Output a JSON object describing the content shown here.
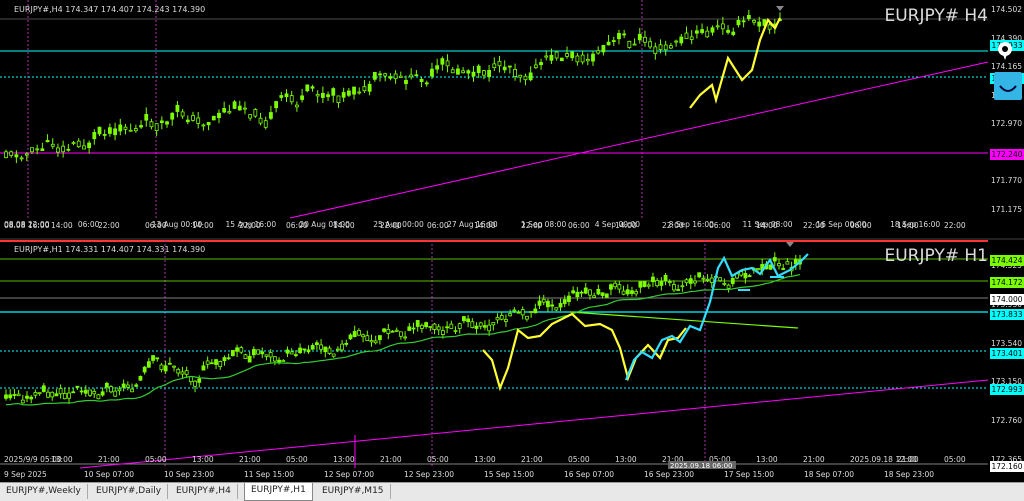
{
  "h4": {
    "header": "EURJPY#,H4  174.347 174.407 174.243 174.390",
    "big_label": "EURJPY#  H4",
    "price_labels": [
      "174.502",
      "174.390",
      "174.165",
      "173.565",
      "172.970",
      "172.370",
      "171.770",
      "171.175"
    ],
    "tags": [
      {
        "text": "173.933",
        "color": "#00ffff"
      },
      {
        "text": "173.601",
        "color": "#00ffff"
      },
      {
        "text": "172.240",
        "color": "#ff00ff"
      }
    ],
    "time_labels": [
      "08.08 22:00",
      "06:00",
      "13 Aug 00:00",
      "15 Aug 16:00",
      "20 Aug 08:00",
      "25 Aug 00:00",
      "27 Aug 16:00",
      "1 Sep 08:00",
      "4 Sep 00:00",
      "8 Sep 16:00",
      "11 Sep 08:00",
      "16 Sep 00:00",
      "18 Sep 16:00"
    ],
    "time_sub": [
      "08.08 16:00",
      "14:00",
      "22:00",
      "06:00",
      "14:00",
      "22:00",
      "06:00",
      "14:00",
      "22:00",
      "06:00",
      "14:00",
      "22:00",
      "06:00",
      "14:00",
      "22:00",
      "06:00",
      "14:00",
      "22:00",
      "06:00",
      "14:00",
      "22:00"
    ]
  },
  "h1": {
    "header": "EURJPY#,H1  174.331 174.407 174.331 174.390",
    "big_label": "EURJPY#  H1",
    "price_labels": [
      "174.325",
      "173.930",
      "173.540",
      "173.150",
      "172.760",
      "172.365"
    ],
    "tags": [
      {
        "text": "174.424",
        "color": "#7cfc00"
      },
      {
        "text": "174.172",
        "color": "#7cfc00"
      },
      {
        "text": "174.000",
        "color": "#ffffff"
      },
      {
        "text": "173.833",
        "color": "#00ffff"
      },
      {
        "text": "173.401",
        "color": "#00ffff"
      },
      {
        "text": "172.993",
        "color": "#00ffff"
      },
      {
        "text": "172.160",
        "color": "#ffffff"
      }
    ],
    "time_labels": [
      "9 Sep 2025",
      "10 Sep 07:00",
      "10 Sep 23:00",
      "11 Sep 15:00",
      "12 Sep 07:00",
      "12 Sep 23:00",
      "15 Sep 15:00",
      "16 Sep 07:00",
      "16 Sep 23:00",
      "17 Sep 15:00",
      "18 Sep 07:00",
      "18 Sep 23:00"
    ],
    "time_sub": [
      "2025/9/9 05:00",
      "13:00",
      "21:00",
      "05:00",
      "13:00",
      "21:00",
      "05:00",
      "13:00",
      "21:00",
      "05:00",
      "13:00",
      "21:00",
      "05:00",
      "13:00",
      "21:00",
      "05:00",
      "13:00",
      "21:00",
      "2025.09.18 12:00",
      "21:00",
      "05:00"
    ],
    "crosshair_time": "2025.09.18 06:00"
  },
  "tabs": [
    "EURJPY#,Weekly",
    "EURJPY#,Daily",
    "EURJPY#,H4",
    "EURJPY#,H1",
    "EURJPY#,M15"
  ],
  "active_tab": "EURJPY#,H1"
}
